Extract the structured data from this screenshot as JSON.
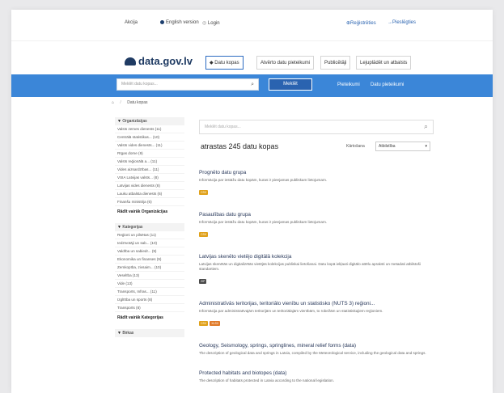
{
  "topbar": {
    "item1": "Akcija",
    "item2": "English version",
    "item3": "Login",
    "register": "Reģistrēties",
    "login": "Pieslēgties"
  },
  "logo": "data.gov.lv",
  "nav": [
    "Datu kopas",
    "Atvērto datu pieteikumi",
    "Publicētāji",
    "Lejuplādēt un atbalsts"
  ],
  "search": {
    "placeholder": "Meklēt datu kopas...",
    "button": "Meklēt",
    "link1": "Pieteikumi",
    "link2": "Datu pieteikumi"
  },
  "breadcrumb": [
    "⌂",
    "/",
    "Datu kopas"
  ],
  "facets": {
    "organizations": {
      "title": "▼ Organizācijas",
      "items": [
        "Valsts zemes dienests (11)",
        "Centrālā statistikas... (10)",
        "Valsts vides dienests... (11)",
        "Rīgas dome (9)",
        "Valsts reģionālā a... (11)",
        "Vides aizsardzības... (11)",
        "VSIA Latvijas valsts... (8)",
        "Latvijas vides dienests (8)",
        "Lauku atbalsta dienests (6)",
        "Finanšu ministrija (6)"
      ],
      "more": "Rādīt vairāk Organizācijas"
    },
    "categories": {
      "title": "▼ Kategorijas",
      "items": [
        "Reģioni un pilsētas (11)",
        "Iedzīvotāji un sab... (10)",
        "Valdība un sabiedr... (9)",
        "Ekonomika un finanses (9)",
        "Zemkopība, zivsaim... (10)",
        "Veselība (13)",
        "Vide (13)",
        "Transports, Infras... (11)",
        "Izglītība un sports (8)",
        "Transports (8)"
      ],
      "more": "Rādīt vairāk Kategorijas"
    },
    "tags": {
      "title": "▼ Birkas"
    }
  },
  "main": {
    "search_placeholder": "Meklēt datu kopas...",
    "count_label": "atrastas 245 datu kopas",
    "sort_label": "Kārtošana",
    "sort_value": "Atbilstība"
  },
  "datasets": [
    {
      "title": "Prognēto datu grupa",
      "desc": "Informācija par iestāžu datu kopām, kuras ir pieejamas publiskam lietojumam.",
      "badges": [
        {
          "text": "CSV",
          "color": "#e0a11a"
        }
      ]
    },
    {
      "title": "Pasaulības datu grupa",
      "desc": "Informācija par iestāžu datu kopām, kuras ir pieejamas publiskam lietojumam.",
      "badges": [
        {
          "text": "CSV",
          "color": "#e0a11a"
        }
      ]
    },
    {
      "title": "Latvijas skenēto vietējo digitālā kolekcija",
      "desc": "Latvijas skenētās un digitalizētās vietējās kolekcijas publiskai lietošanai. Datu kopā iekļauti digitālo attēlu apraksti un metadati atbilstoši standartiem.",
      "badges": [
        {
          "text": "ZIP",
          "color": "#4a4a4a"
        }
      ]
    },
    {
      "title": "Administratīvās teritorijas, teritoriālo vienību un statistisko (NUTS 3) reģioni...",
      "desc": "Informācija par administratīvajām teritorijām un teritoriālajām vienībām, to robežām un statistiskajiem reģioniem.",
      "badges": [
        {
          "text": "CSV",
          "color": "#e0a11a"
        },
        {
          "text": "XLSX",
          "color": "#e07b2a"
        }
      ]
    },
    {
      "title": "Geology, Seismology, springs, springlines, mineral relief forms (data)",
      "desc": "The description of geological data and springs in Latvia, compiled by the Meteorological service, including the geological data and springs.",
      "badges": []
    },
    {
      "title": "Protected habitats and biotopes (data)",
      "desc": "The description of habitats protected in Latvia according to the national legislation.",
      "badges": []
    }
  ]
}
